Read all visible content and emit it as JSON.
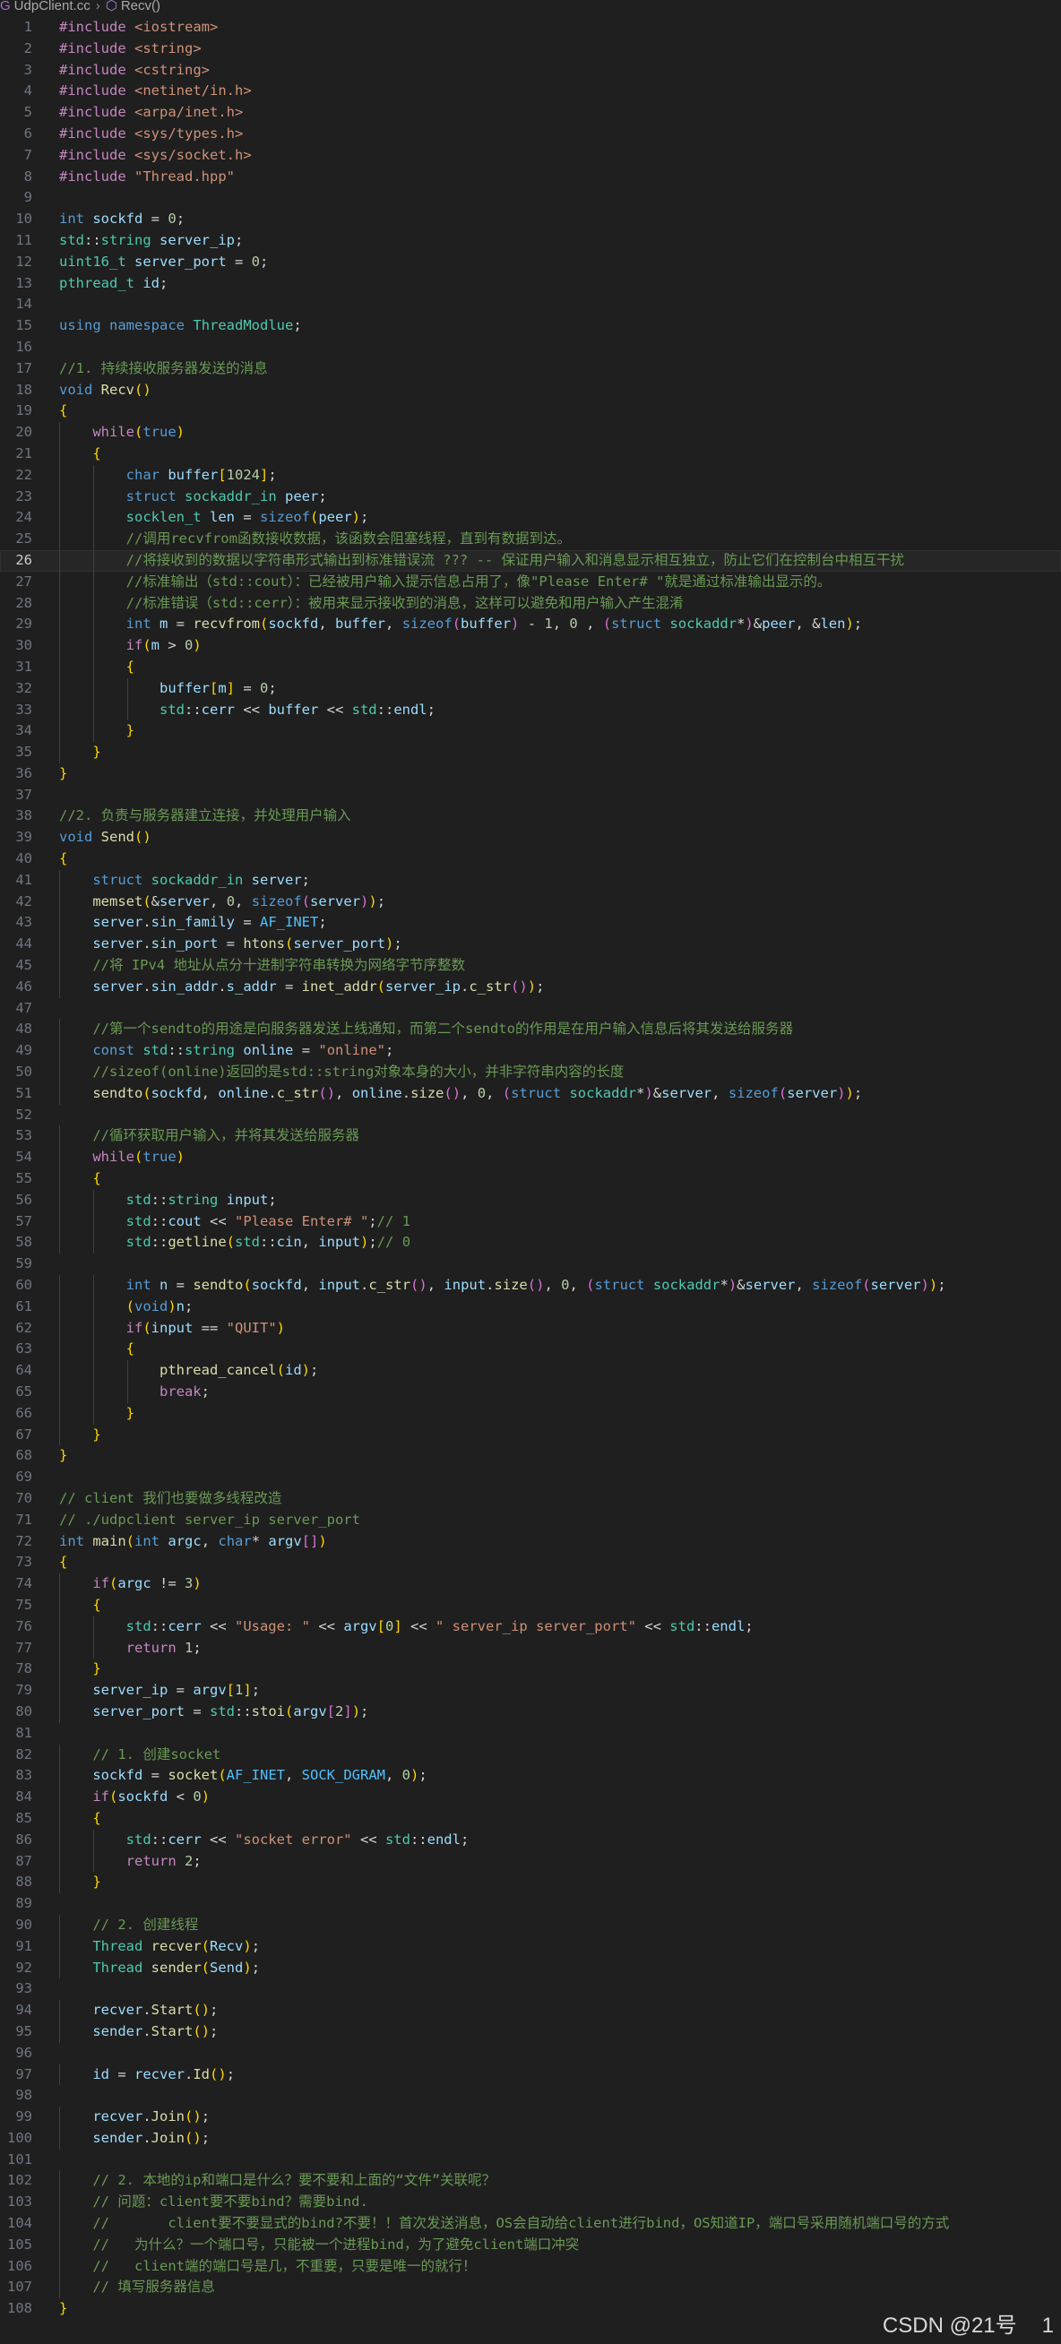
{
  "breadcrumb": {
    "file": "UdpClient.cc",
    "symbol": "Recv()"
  },
  "editor": {
    "language": "cpp",
    "current_line": 26,
    "lines": [
      "#include <iostream>",
      "#include <string>",
      "#include <cstring>",
      "#include <netinet/in.h>",
      "#include <arpa/inet.h>",
      "#include <sys/types.h>",
      "#include <sys/socket.h>",
      "#include \"Thread.hpp\"",
      "",
      "int sockfd = 0;",
      "std::string server_ip;",
      "uint16_t server_port = 0;",
      "pthread_t id;",
      "",
      "using namespace ThreadModlue;",
      "",
      "//1. 持续接收服务器发送的消息",
      "void Recv()",
      "{",
      "    while(true)",
      "    {",
      "        char buffer[1024];",
      "        struct sockaddr_in peer;",
      "        socklen_t len = sizeof(peer);",
      "        //调用recvfrom函数接收数据，该函数会阻塞线程，直到有数据到达。",
      "        //将接收到的数据以字符串形式输出到标准错误流 ??? -- 保证用户输入和消息显示相互独立，防止它们在控制台中相互干扰",
      "        //标准输出（std::cout）：已经被用户输入提示信息占用了，像\"Please Enter# \"就是通过标准输出显示的。",
      "        //标准错误（std::cerr）：被用来显示接收到的消息，这样可以避免和用户输入产生混淆",
      "        int m = recvfrom(sockfd, buffer, sizeof(buffer) - 1, 0 , (struct sockaddr*)&peer, &len);",
      "        if(m > 0)",
      "        {",
      "            buffer[m] = 0;",
      "            std::cerr << buffer << std::endl;",
      "        }",
      "    }",
      "}",
      "",
      "//2. 负责与服务器建立连接，并处理用户输入",
      "void Send()",
      "{",
      "    struct sockaddr_in server;",
      "    memset(&server, 0, sizeof(server));",
      "    server.sin_family = AF_INET;",
      "    server.sin_port = htons(server_port);",
      "    //将 IPv4 地址从点分十进制字符串转换为网络字节序整数",
      "    server.sin_addr.s_addr = inet_addr(server_ip.c_str());",
      "",
      "    //第一个sendto的用途是向服务器发送上线通知，而第二个sendto的作用是在用户输入信息后将其发送给服务器",
      "    const std::string online = \"online\";",
      "    //sizeof(online)返回的是std::string对象本身的大小，并非字符串内容的长度",
      "    sendto(sockfd, online.c_str(), online.size(), 0, (struct sockaddr*)&server, sizeof(server));",
      "",
      "    //循环获取用户输入，并将其发送给服务器",
      "    while(true)",
      "    {",
      "        std::string input;",
      "        std::cout << \"Please Enter# \";// 1",
      "        std::getline(std::cin, input);// 0",
      "",
      "        int n = sendto(sockfd, input.c_str(), input.size(), 0, (struct sockaddr*)&server, sizeof(server));",
      "        (void)n;",
      "        if(input == \"QUIT\")",
      "        {",
      "            pthread_cancel(id);",
      "            break;",
      "        }",
      "    }",
      "}",
      "",
      "// client 我们也要做多线程改造",
      "// ./udpclient server_ip server_port",
      "int main(int argc, char* argv[])",
      "{",
      "    if(argc != 3)",
      "    {",
      "        std::cerr << \"Usage: \" << argv[0] << \" server_ip server_port\" << std::endl;",
      "        return 1;",
      "    }",
      "    server_ip = argv[1];",
      "    server_port = std::stoi(argv[2]);",
      "",
      "    // 1. 创建socket",
      "    sockfd = socket(AF_INET, SOCK_DGRAM, 0);",
      "    if(sockfd < 0)",
      "    {",
      "        std::cerr << \"socket error\" << std::endl;",
      "        return 2;",
      "    }",
      "",
      "    // 2. 创建线程",
      "    Thread recver(Recv);",
      "    Thread sender(Send);",
      "",
      "    recver.Start();",
      "    sender.Start();",
      "",
      "    id = recver.Id();",
      "",
      "    recver.Join();",
      "    sender.Join();",
      "",
      "    // 2. 本地的ip和端口是什么？要不要和上面的“文件”关联呢？",
      "    // 问题：client要不要bind？需要bind.",
      "    //       client要不要显式的bind?不要！！首次发送消息，OS会自动给client进行bind，OS知道IP，端口号采用随机端口号的方式",
      "    //   为什么？一个端口号，只能被一个进程bind，为了避免client端口冲突",
      "    //   client端的端口号是几，不重要，只要是唯一的就行！",
      "    // 填写服务器信息",
      "}"
    ]
  },
  "watermark": {
    "text": "CSDN @21号",
    "tail": "1"
  }
}
